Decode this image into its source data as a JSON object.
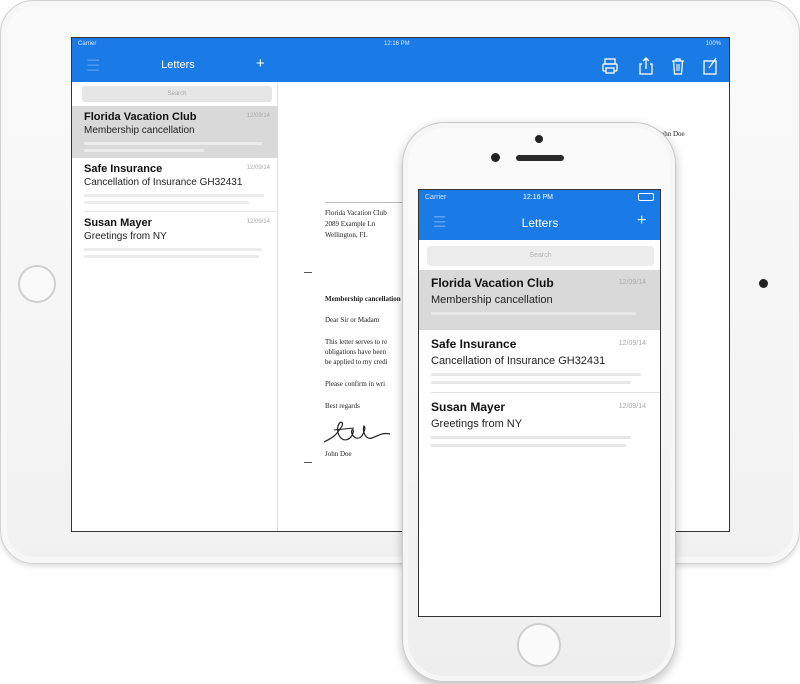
{
  "ipad": {
    "status": {
      "left": "Carrier",
      "time": "12:16 PM",
      "right": "100%"
    },
    "nav": {
      "title": "Letters",
      "add": "+"
    },
    "search_placeholder": "Search",
    "letters": [
      {
        "title": "Florida Vacation Club",
        "subtitle": "Membership cancellation",
        "date": "12/09/14"
      },
      {
        "title": "Safe Insurance",
        "subtitle": "Cancellation of Insurance GH32431",
        "date": "12/09/14"
      },
      {
        "title": "Susan Mayer",
        "subtitle": "Greetings from NY",
        "date": "12/09/14"
      }
    ],
    "document": {
      "sender_top": "John Doe",
      "recipient_name": "Florida Vacation Club",
      "recipient_street": "2089 Example Ln",
      "recipient_city": "Wellington, FL",
      "subject": "Membership cancellation",
      "salutation": "Dear Sir or Madam",
      "body_1": "This letter serves to re",
      "body_2": "obligations have been",
      "body_3": "be applied to my credi",
      "body_4": "Please confirm in wri",
      "closing": "Best regards",
      "signature_name": "John Doe"
    }
  },
  "iphone": {
    "status": {
      "left": "Carrier",
      "time": "12:16 PM"
    },
    "nav": {
      "title": "Letters",
      "add": "+"
    },
    "search_placeholder": "Search",
    "letters": [
      {
        "title": "Florida Vacation Club",
        "subtitle": "Membership cancellation",
        "date": "12/09/14"
      },
      {
        "title": "Safe Insurance",
        "subtitle": "Cancellation of Insurance GH32431",
        "date": "12/09/14"
      },
      {
        "title": "Susan Mayer",
        "subtitle": "Greetings from NY",
        "date": "12/09/14"
      }
    ]
  },
  "colors": {
    "accent": "#1b7be6",
    "selected_row": "#d9d9d9"
  }
}
